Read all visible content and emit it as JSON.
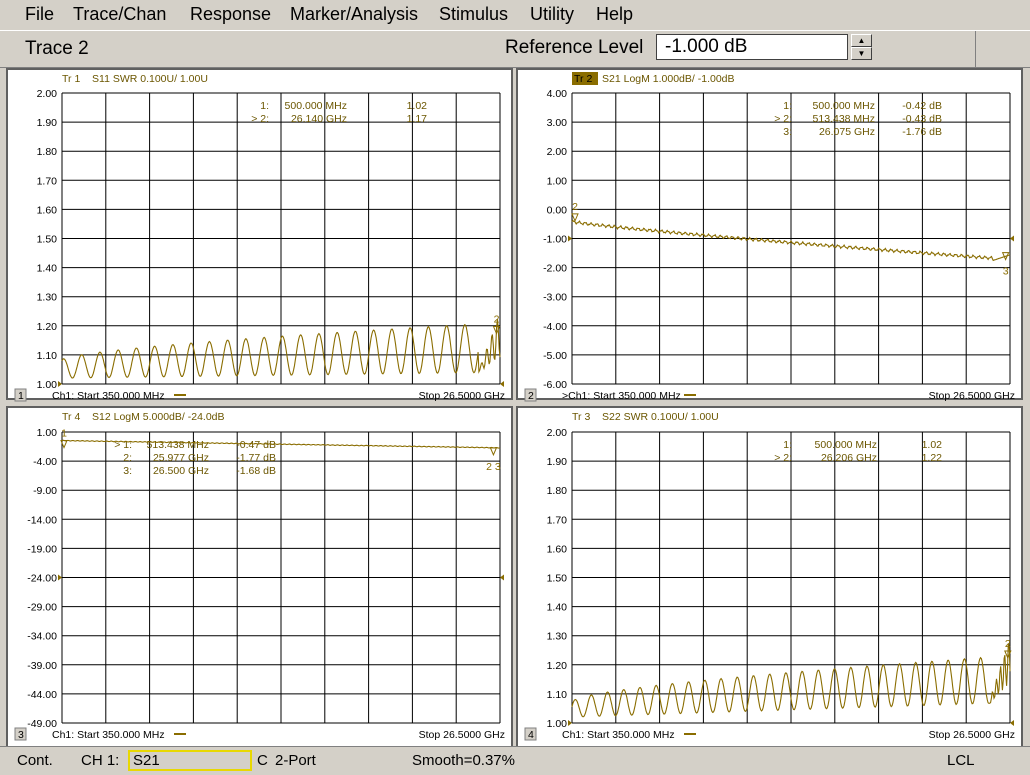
{
  "menu": {
    "file": "File",
    "trace": "Trace/Chan",
    "response": "Response",
    "marker": "Marker/Analysis",
    "stimulus": "Stimulus",
    "utility": "Utility",
    "help": "Help"
  },
  "toolbar": {
    "trace_label": "Trace 2",
    "ref_label": "Reference Level",
    "ref_value": "-1.000 dB"
  },
  "colors": {
    "trace": "#8a6d00",
    "grid": "#000000",
    "text": "#6b5600",
    "bg": "#ffffff",
    "window": "#d4d0c8"
  },
  "panes": [
    {
      "num": "1",
      "title_tr": "Tr 1",
      "title_rest": "S11 SWR 0.100U/ 1.00U",
      "active": false,
      "yticks": [
        "2.00",
        "1.90",
        "1.80",
        "1.70",
        "1.60",
        "1.50",
        "1.40",
        "1.30",
        "1.20",
        "1.10",
        "1.00"
      ],
      "ymax": 2.0,
      "ymin": 1.0,
      "markers": [
        {
          "prefix": "1:",
          "freq": "500.000 MHz",
          "val": "1.02"
        },
        {
          "prefix": "> 2:",
          "freq": "26.140 GHz",
          "val": "1.17"
        }
      ],
      "footer_start": "Ch1: Start  350.000 MHz",
      "footer_stop": "Stop  26.5000 GHz",
      "trace_type": "swr1"
    },
    {
      "num": "2",
      "title_tr": "Tr 2",
      "title_rest": "S21 LogM 1.000dB/ -1.00dB",
      "active": true,
      "yticks": [
        "4.00",
        "3.00",
        "2.00",
        "1.00",
        "0.00",
        "-1.00",
        "-2.00",
        "-3.00",
        "-4.00",
        "-5.00",
        "-6.00"
      ],
      "ymax": 4.0,
      "ymin": -6.0,
      "markers": [
        {
          "prefix": "1:",
          "freq": "500.000 MHz",
          "val": "-0.42 dB"
        },
        {
          "prefix": "> 2:",
          "freq": "513.438 MHz",
          "val": "-0.43 dB"
        },
        {
          "prefix": "3:",
          "freq": "26.075 GHz",
          "val": "-1.76 dB"
        }
      ],
      "footer_start": ">Ch1: Start  350.000 MHz",
      "footer_stop": "Stop  26.5000 GHz",
      "trace_type": "s21"
    },
    {
      "num": "3",
      "title_tr": "Tr 4",
      "title_rest": "S12 LogM 5.000dB/ -24.0dB",
      "active": false,
      "yticks": [
        "1.00",
        "-4.00",
        "-9.00",
        "-14.00",
        "-19.00",
        "-24.00",
        "-29.00",
        "-34.00",
        "-39.00",
        "-44.00",
        "-49.00"
      ],
      "ymax": 1.0,
      "ymin": -49.0,
      "markers": [
        {
          "prefix": "> 1:",
          "freq": "513.438 MHz",
          "val": "-0.47 dB"
        },
        {
          "prefix": "2:",
          "freq": "25.977 GHz",
          "val": "-1.77 dB"
        },
        {
          "prefix": "3:",
          "freq": "26.500 GHz",
          "val": "-1.68 dB"
        }
      ],
      "footer_start": "Ch1: Start  350.000 MHz",
      "footer_stop": "Stop  26.5000 GHz",
      "trace_type": "s12"
    },
    {
      "num": "4",
      "title_tr": "Tr 3",
      "title_rest": "S22 SWR 0.100U/ 1.00U",
      "active": false,
      "yticks": [
        "2.00",
        "1.90",
        "1.80",
        "1.70",
        "1.60",
        "1.50",
        "1.40",
        "1.30",
        "1.20",
        "1.10",
        "1.00"
      ],
      "ymax": 2.0,
      "ymin": 1.0,
      "markers": [
        {
          "prefix": "1:",
          "freq": "500.000 MHz",
          "val": "1.02"
        },
        {
          "prefix": "> 2:",
          "freq": "26.206 GHz",
          "val": "1.22"
        }
      ],
      "footer_start": "Ch1: Start  350.000 MHz",
      "footer_stop": "Stop  26.5000 GHz",
      "trace_type": "swr4"
    }
  ],
  "status": {
    "mode": "Cont.",
    "ch": "CH 1:",
    "param": "S21",
    "cal": "C",
    "port": "2-Port",
    "smooth": "Smooth=0.37%",
    "lcl": "LCL"
  }
}
